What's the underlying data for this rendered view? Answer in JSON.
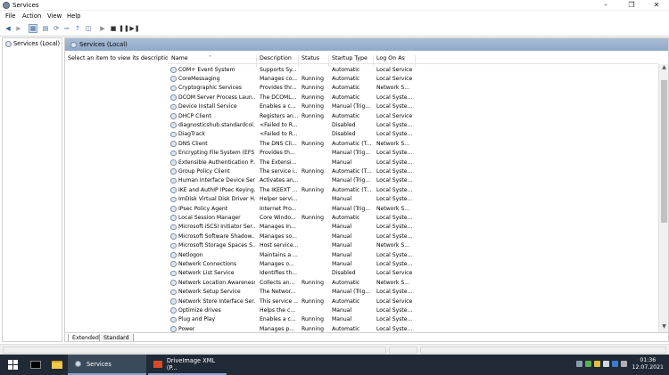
{
  "window": {
    "title": "Services"
  },
  "menu": [
    "File",
    "Action",
    "View",
    "Help"
  ],
  "tree": {
    "root_label": "Services (Local)"
  },
  "main": {
    "header_label": "Services (Local)",
    "description_hint": "Select an item to view its description."
  },
  "columns": [
    "Name",
    "Description",
    "Status",
    "Startup Type",
    "Log On As"
  ],
  "services": [
    [
      "COM+ Event System",
      "Supports Sy...",
      "",
      "Automatic",
      "Local Service"
    ],
    [
      "CoreMessaging",
      "Manages co...",
      "Running",
      "Automatic",
      "Local Service"
    ],
    [
      "Cryptographic Services",
      "Provides thr...",
      "Running",
      "Automatic",
      "Network S..."
    ],
    [
      "DCOM Server Process Laun...",
      "The DCOML...",
      "Running",
      "Automatic",
      "Local Syste..."
    ],
    [
      "Device Install Service",
      "Enables a c...",
      "Running",
      "Manual (Trig...",
      "Local Syste..."
    ],
    [
      "DHCP Client",
      "Registers an...",
      "Running",
      "Automatic",
      "Local Service"
    ],
    [
      "diagnosticshub.standardcol...",
      "<Failed to R...",
      "",
      "Disabled",
      "Local Syste..."
    ],
    [
      "DiagTrack",
      "<Failed to R...",
      "",
      "Disabled",
      "Local Syste..."
    ],
    [
      "DNS Client",
      "The DNS Cli...",
      "Running",
      "Automatic (T...",
      "Network S..."
    ],
    [
      "Encrypting File System (EFS)",
      "Provides th...",
      "",
      "Manual (Trig...",
      "Local Syste..."
    ],
    [
      "Extensible Authentication P...",
      "The Extensi...",
      "",
      "Manual",
      "Local Syste..."
    ],
    [
      "Group Policy Client",
      "The service i...",
      "Running",
      "Automatic (T...",
      "Local Syste..."
    ],
    [
      "Human Interface Device Ser...",
      "Activates an...",
      "",
      "Manual (Trig...",
      "Local Syste..."
    ],
    [
      "IKE and AuthIP IPsec Keying...",
      "The IKEEXT ...",
      "Running",
      "Automatic (T...",
      "Local Syste..."
    ],
    [
      "ImDisk Virtual Disk Driver H...",
      "Helper servi...",
      "",
      "Manual",
      "Local Syste..."
    ],
    [
      "IPsec Policy Agent",
      "Internet Pro...",
      "",
      "Manual (Trig...",
      "Network S..."
    ],
    [
      "Local Session Manager",
      "Core Windo...",
      "Running",
      "Automatic",
      "Local Syste..."
    ],
    [
      "Microsoft iSCSI Initiator Ser...",
      "Manages In...",
      "",
      "Manual",
      "Local Syste..."
    ],
    [
      "Microsoft Software Shadow...",
      "Manages so...",
      "",
      "Manual",
      "Local Syste..."
    ],
    [
      "Microsoft Storage Spaces S...",
      "Host service...",
      "",
      "Manual",
      "Network S..."
    ],
    [
      "Netlogon",
      "Maintains a ...",
      "",
      "Manual",
      "Local Syste..."
    ],
    [
      "Network Connections",
      "Manages o...",
      "",
      "Manual",
      "Local Syste..."
    ],
    [
      "Network List Service",
      "Identifies th...",
      "",
      "Disabled",
      "Local Service"
    ],
    [
      "Network Location Awareness",
      "Collects an...",
      "Running",
      "Automatic",
      "Network S..."
    ],
    [
      "Network Setup Service",
      "The Networ...",
      "",
      "Manual (Trig...",
      "Local Syste..."
    ],
    [
      "Network Store Interface Ser...",
      "This service ...",
      "Running",
      "Automatic",
      "Local Service"
    ],
    [
      "Optimize drives",
      "Helps the c...",
      "",
      "Manual",
      "Local Syste..."
    ],
    [
      "Plug and Play",
      "Enables a c...",
      "Running",
      "Manual",
      "Local Syste..."
    ],
    [
      "Power",
      "Manages p...",
      "Running",
      "Automatic",
      "Local Syste..."
    ]
  ],
  "tabs": [
    "Extended",
    "Standard"
  ],
  "taskbar": {
    "apps": [
      "Services",
      "DriveImage XML (P..."
    ],
    "time": "01:36",
    "date": "12.07.2021"
  },
  "colors": {
    "header_gradient": "#a9bdd5",
    "taskbar": "#1f2a36",
    "active_task": "#3b4a5a"
  }
}
